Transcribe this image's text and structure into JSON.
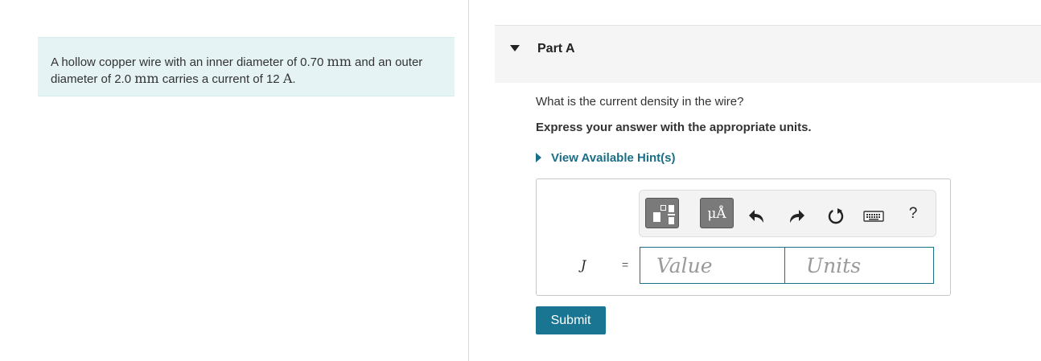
{
  "problem": {
    "text_1": "A hollow copper wire with an inner diameter of 0.70 ",
    "unit_mm_1": "mm",
    "text_2": " and an outer diameter of 2.0 ",
    "unit_mm_2": "mm",
    "text_3": " carries a current of 12 ",
    "unit_a": "A",
    "text_4": "."
  },
  "part": {
    "title": "Part A"
  },
  "question": {
    "prompt": "What is the current density in the wire?",
    "instruction": "Express your answer with the appropriate units."
  },
  "hints": {
    "label": "View Available Hint(s)"
  },
  "toolbar": {
    "units_label": "μÅ",
    "help_label": "?",
    "icons": [
      "templates-icon",
      "units-icon",
      "undo-icon",
      "redo-icon",
      "reset-icon",
      "keyboard-icon",
      "help-icon"
    ]
  },
  "answer": {
    "variable": "J",
    "equals": "=",
    "value_placeholder": "Value",
    "value": "",
    "units_placeholder": "Units",
    "units": ""
  },
  "submit": {
    "label": "Submit"
  },
  "colors": {
    "accent": "#1a6e85",
    "submit_bg": "#197591",
    "problem_bg": "#e5f3f5",
    "toolbar_button": "#7a7a7a"
  }
}
